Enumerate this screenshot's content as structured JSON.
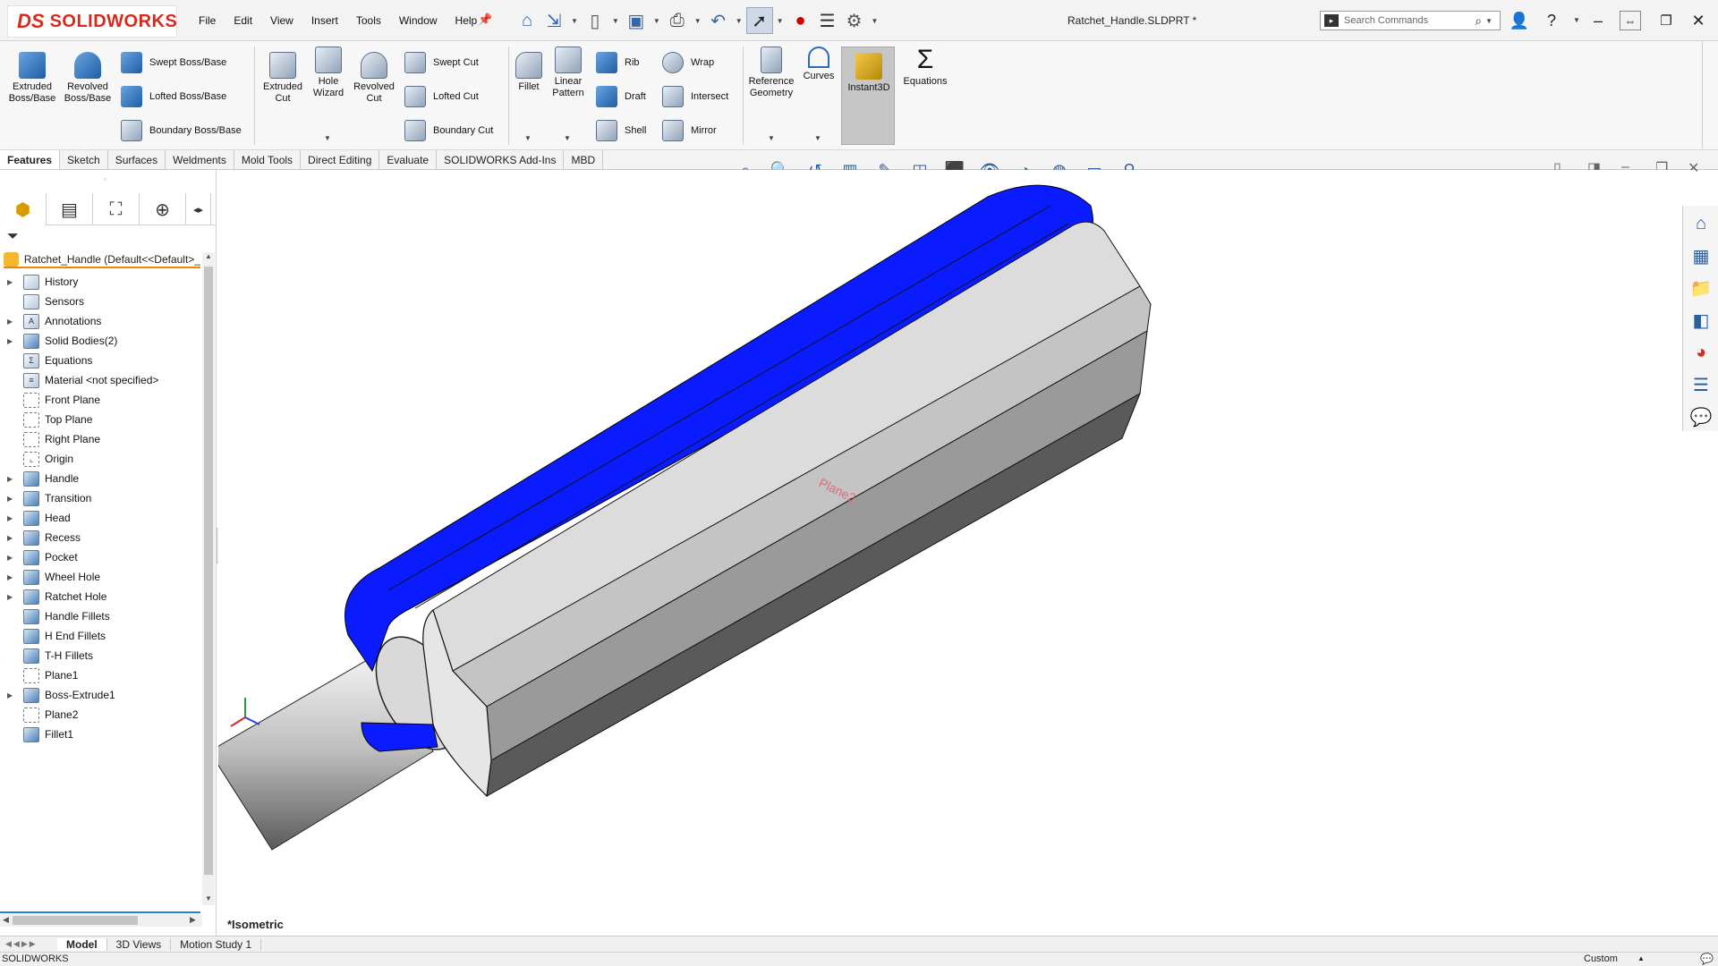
{
  "app": {
    "brand": "SOLIDWORKS",
    "document_title": "Ratchet_Handle.SLDPRT *"
  },
  "menu": [
    "File",
    "Edit",
    "View",
    "Insert",
    "Tools",
    "Window",
    "Help"
  ],
  "search": {
    "placeholder": "Search Commands"
  },
  "ribbon": {
    "extruded_boss": "Extruded Boss/Base",
    "revolved_boss": "Revolved Boss/Base",
    "swept_boss": "Swept Boss/Base",
    "lofted_boss": "Lofted Boss/Base",
    "boundary_boss": "Boundary Boss/Base",
    "extruded_cut": "Extruded Cut",
    "hole_wizard": "Hole Wizard",
    "revolved_cut": "Revolved Cut",
    "swept_cut": "Swept Cut",
    "lofted_cut": "Lofted Cut",
    "boundary_cut": "Boundary Cut",
    "fillet": "Fillet",
    "linear_pattern": "Linear Pattern",
    "rib": "Rib",
    "draft": "Draft",
    "shell": "Shell",
    "wrap": "Wrap",
    "intersect": "Intersect",
    "mirror": "Mirror",
    "reference_geometry": "Reference Geometry",
    "curves": "Curves",
    "instant3d": "Instant3D",
    "equations": "Equations"
  },
  "tabs": [
    "Features",
    "Sketch",
    "Surfaces",
    "Weldments",
    "Mold Tools",
    "Direct Editing",
    "Evaluate",
    "SOLIDWORKS Add-Ins",
    "MBD"
  ],
  "tree": {
    "root": "Ratchet_Handle  (Default<<Default>_",
    "items": [
      {
        "label": "History",
        "expandable": true
      },
      {
        "label": "Sensors",
        "expandable": false
      },
      {
        "label": "Annotations",
        "expandable": true
      },
      {
        "label": "Solid Bodies(2)",
        "expandable": true
      },
      {
        "label": "Equations",
        "expandable": false
      },
      {
        "label": "Material <not specified>",
        "expandable": false
      },
      {
        "label": "Front Plane",
        "expandable": false
      },
      {
        "label": "Top Plane",
        "expandable": false
      },
      {
        "label": "Right Plane",
        "expandable": false
      },
      {
        "label": "Origin",
        "expandable": false
      },
      {
        "label": "Handle",
        "expandable": true
      },
      {
        "label": "Transition",
        "expandable": true
      },
      {
        "label": "Head",
        "expandable": true
      },
      {
        "label": "Recess",
        "expandable": true
      },
      {
        "label": "Pocket",
        "expandable": true
      },
      {
        "label": "Wheel Hole",
        "expandable": true
      },
      {
        "label": "Ratchet Hole",
        "expandable": true
      },
      {
        "label": "Handle Fillets",
        "expandable": false
      },
      {
        "label": "H End Fillets",
        "expandable": false
      },
      {
        "label": "T-H Fillets",
        "expandable": false
      },
      {
        "label": "Plane1",
        "expandable": false
      },
      {
        "label": "Boss-Extrude1",
        "expandable": true
      },
      {
        "label": "Plane2",
        "expandable": false
      },
      {
        "label": "Fillet1",
        "expandable": false
      }
    ]
  },
  "viewport": {
    "view_name": "*Isometric",
    "plane_label": "Plane2"
  },
  "bottom_tabs": [
    "Model",
    "3D Views",
    "Motion Study 1"
  ],
  "status": {
    "left": "SOLIDWORKS",
    "units": "Custom"
  },
  "colors": {
    "selection_blue": "#0a1cff",
    "brand_red": "#d52b1e",
    "accent": "#2a7fd4"
  }
}
